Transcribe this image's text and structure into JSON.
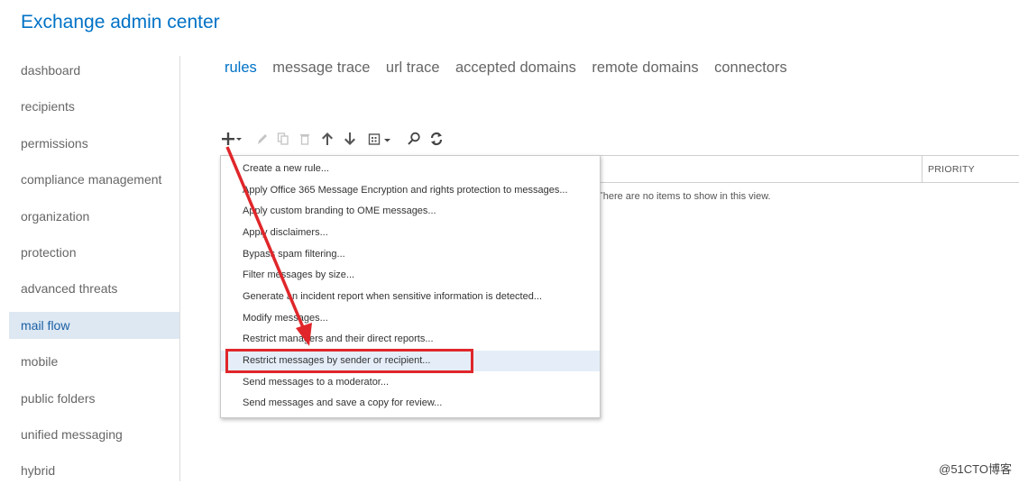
{
  "app": {
    "title": "Exchange admin center"
  },
  "sidebar": {
    "items": [
      {
        "label": "dashboard",
        "selected": false
      },
      {
        "label": "recipients",
        "selected": false
      },
      {
        "label": "permissions",
        "selected": false
      },
      {
        "label": "compliance management",
        "selected": false
      },
      {
        "label": "organization",
        "selected": false
      },
      {
        "label": "protection",
        "selected": false
      },
      {
        "label": "advanced threats",
        "selected": false
      },
      {
        "label": "mail flow",
        "selected": true
      },
      {
        "label": "mobile",
        "selected": false
      },
      {
        "label": "public folders",
        "selected": false
      },
      {
        "label": "unified messaging",
        "selected": false
      },
      {
        "label": "hybrid",
        "selected": false
      }
    ]
  },
  "tabs": [
    {
      "label": "rules",
      "active": true
    },
    {
      "label": "message trace",
      "active": false
    },
    {
      "label": "url trace",
      "active": false
    },
    {
      "label": "accepted domains",
      "active": false
    },
    {
      "label": "remote domains",
      "active": false
    },
    {
      "label": "connectors",
      "active": false
    }
  ],
  "toolbar": {
    "icons": [
      "plus-icon",
      "chevron-down-icon",
      "pencil-icon",
      "copy-icon",
      "trash-icon",
      "arrow-up-icon",
      "arrow-down-icon",
      "export-icon",
      "search-icon",
      "refresh-icon"
    ]
  },
  "table": {
    "columns": {
      "priority": "PRIORITY"
    },
    "empty_message": "There are no items to show in this view."
  },
  "dropdown": {
    "items": [
      "Create a new rule...",
      "Apply Office 365 Message Encryption and rights protection to messages...",
      "Apply custom branding to OME messages...",
      "Apply disclaimers...",
      "Bypass spam filtering...",
      "Filter messages by size...",
      "Generate an incident report when sensitive information is detected...",
      "Modify messages...",
      "Restrict managers and their direct reports...",
      "Restrict messages by sender or recipient...",
      "Send messages to a moderator...",
      "Send messages and save a copy for review..."
    ],
    "hovered_index": 9
  },
  "annotation": {
    "color": "#e0262a"
  },
  "watermark": "@51CTO博客",
  "colors": {
    "accent": "#0072c6",
    "selected_bg": "#dde8f3",
    "hover_bg": "#e5eef8"
  }
}
